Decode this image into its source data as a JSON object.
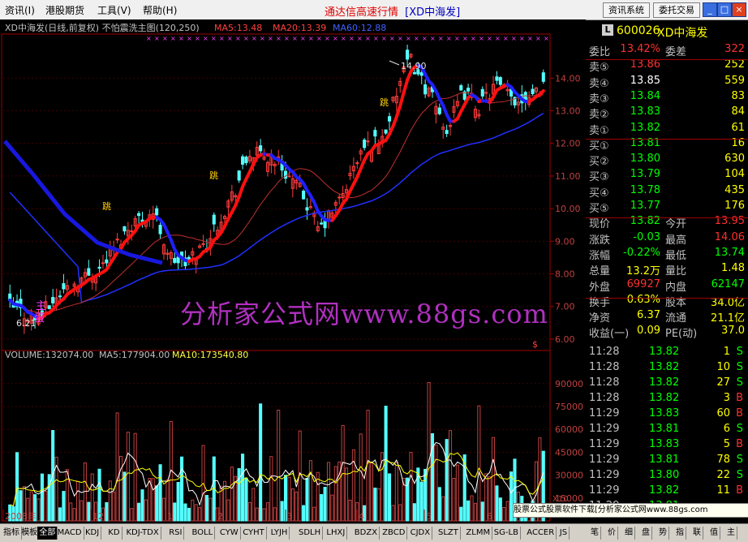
{
  "menu": {
    "items": [
      "资讯(I)",
      "港股期货",
      "工具(V)",
      "帮助(H)"
    ],
    "title": "通达信高速行情",
    "title_code": "XD中海发",
    "btn_news": "资讯系统",
    "btn_trade": "委托交易"
  },
  "header": {
    "name": "XD中海发(日线,前复权) 不怕震洗主图(120,250)",
    "ma5": "MA5:13.48",
    "ma20": "MA20:13.39",
    "ma60": "MA60:12.88"
  },
  "annotations": {
    "high_label": "14.90",
    "low_label": "6.21",
    "zhu": "主",
    "dan": "蛋",
    "tip": "跳"
  },
  "watermark": "分析家公式网www.88gs.com",
  "volume_header": {
    "volume": "VOLUME:132074.00",
    "ma5": "MA5:177904.00",
    "ma10": "MA10:173540.80"
  },
  "price_axis": [
    "14.00",
    "13.00",
    "12.00",
    "11.00",
    "10.00",
    "9.00",
    "8.00",
    "7.00",
    "6.00"
  ],
  "volume_axis": [
    "90000",
    "75000",
    "60000",
    "45000",
    "30000",
    "15000"
  ],
  "volume_unit": "X10",
  "time_axis": [
    "2008年",
    "12",
    "1",
    "2",
    "3",
    "4",
    "5",
    "6"
  ],
  "chart_data": {
    "type": "candlestick",
    "price_range": [
      5.8,
      15.3
    ],
    "volume_range": [
      0,
      100000
    ],
    "high": 14.9,
    "low": 6.21,
    "ma_values": {
      "MA5": 13.48,
      "MA20": 13.39,
      "MA60": 12.88
    },
    "volume_values": {
      "VOLUME": 132074.0,
      "MA5": 177904.0,
      "MA10": 173540.8
    }
  },
  "quote": {
    "code": "600026",
    "name": "XD中海发",
    "rows": [
      {
        "l1": "委比",
        "v1": "13.42%",
        "c1": "#ff3030",
        "l2": "委差",
        "v2": "322",
        "c2": "#ff3030"
      },
      {
        "l1": "卖⑤",
        "v1": "13.86",
        "c1": "#ff3030",
        "v2": "252",
        "c2": "#ffff00"
      },
      {
        "l1": "卖④",
        "v1": "13.85",
        "c1": "#ffffff",
        "v2": "559",
        "c2": "#ffff00"
      },
      {
        "l1": "卖③",
        "v1": "13.84",
        "c1": "#00ff00",
        "v2": "83",
        "c2": "#ffff00"
      },
      {
        "l1": "卖②",
        "v1": "13.83",
        "c1": "#00ff00",
        "v2": "84",
        "c2": "#ffff00"
      },
      {
        "l1": "卖①",
        "v1": "13.82",
        "c1": "#00ff00",
        "v2": "61",
        "c2": "#ffff00"
      },
      {
        "l1": "买①",
        "v1": "13.81",
        "c1": "#00ff00",
        "v2": "16",
        "c2": "#ffff00"
      },
      {
        "l1": "买②",
        "v1": "13.80",
        "c1": "#00ff00",
        "v2": "630",
        "c2": "#ffff00"
      },
      {
        "l1": "买③",
        "v1": "13.79",
        "c1": "#00ff00",
        "v2": "104",
        "c2": "#ffff00"
      },
      {
        "l1": "买④",
        "v1": "13.78",
        "c1": "#00ff00",
        "v2": "435",
        "c2": "#ffff00"
      },
      {
        "l1": "买⑤",
        "v1": "13.77",
        "c1": "#00ff00",
        "v2": "176",
        "c2": "#ffff00"
      },
      {
        "l1": "现价",
        "v1": "13.82",
        "c1": "#00ff00",
        "l2": "今开",
        "v2": "13.95",
        "c2": "#ff3030"
      },
      {
        "l1": "涨跌",
        "v1": "-0.03",
        "c1": "#00ff00",
        "l2": "最高",
        "v2": "14.06",
        "c2": "#ff3030"
      },
      {
        "l1": "涨幅",
        "v1": "-0.22%",
        "c1": "#00ff00",
        "l2": "最低",
        "v2": "13.74",
        "c2": "#00ff00"
      },
      {
        "l1": "总量",
        "v1": "13.2万",
        "c1": "#ffff00",
        "l2": "量比",
        "v2": "1.48",
        "c2": "#ffff00"
      },
      {
        "l1": "外盘",
        "v1": "69927",
        "c1": "#ff3030",
        "l2": "内盘",
        "v2": "62147",
        "c2": "#00ff00"
      },
      {
        "l1": "换手",
        "v1": "0.63%",
        "c1": "#ffff00",
        "l2": "股本",
        "v2": "34.0亿",
        "c2": "#ffff00"
      },
      {
        "l1": "净资",
        "v1": "6.37",
        "c1": "#ffff00",
        "l2": "流通",
        "v2": "21.1亿",
        "c2": "#ffff00"
      },
      {
        "l1": "收益(一)",
        "v1": "0.09",
        "c1": "#ffff00",
        "l2": "PE(动)",
        "v2": "37.0",
        "c2": "#ffff00"
      }
    ],
    "ticks": [
      {
        "t": "11:28",
        "p": "13.82",
        "v": "1",
        "s": "S"
      },
      {
        "t": "11:28",
        "p": "13.82",
        "v": "10",
        "s": "S"
      },
      {
        "t": "11:28",
        "p": "13.82",
        "v": "27",
        "s": "S"
      },
      {
        "t": "11:28",
        "p": "13.82",
        "v": "3",
        "s": "B"
      },
      {
        "t": "11:29",
        "p": "13.83",
        "v": "60",
        "s": "B"
      },
      {
        "t": "11:29",
        "p": "13.81",
        "v": "6",
        "s": "S"
      },
      {
        "t": "11:29",
        "p": "13.83",
        "v": "5",
        "s": "B"
      },
      {
        "t": "11:29",
        "p": "13.81",
        "v": "78",
        "s": "S"
      },
      {
        "t": "11:29",
        "p": "13.80",
        "v": "22",
        "s": "S"
      },
      {
        "t": "11:29",
        "p": "13.82",
        "v": "11",
        "s": "B"
      },
      {
        "t": "11:29",
        "p": "13.81",
        "v": "",
        "s": ""
      }
    ]
  },
  "bottom_tabs": [
    "指标",
    "模板",
    "全部",
    "MACD",
    "KDJ",
    "KD",
    "KDJ-TDX",
    "RSI",
    "BOLL",
    "CYW",
    "CYHT",
    "LYJH",
    "SDLH",
    "LHXJ",
    "BDZX",
    "ZBCD",
    "CJDX",
    "SLZT",
    "ZLMM",
    "SG-LB",
    "ACCER",
    "JS"
  ],
  "quote_tabs": [
    "笔",
    "价",
    "细",
    "盘",
    "势",
    "指",
    "联",
    "值",
    "主"
  ],
  "ad_text": "股票公式股票软件下载[分析家公式网www.88gs.com"
}
